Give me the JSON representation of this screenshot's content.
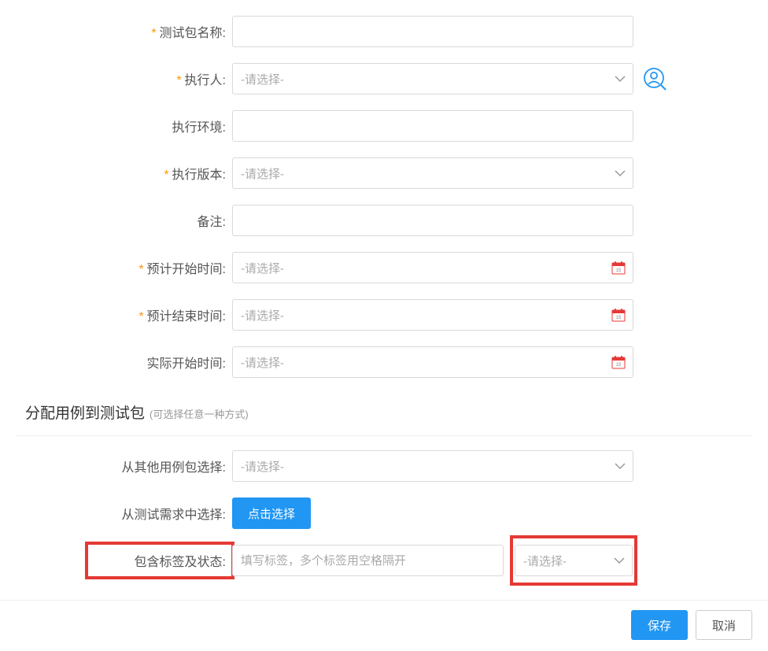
{
  "fields": {
    "package_name": {
      "label": "测试包名称:",
      "required": true,
      "value": ""
    },
    "executor": {
      "label": "执行人:",
      "required": true,
      "placeholder": "-请选择-"
    },
    "env": {
      "label": "执行环境:",
      "required": false,
      "value": ""
    },
    "version": {
      "label": "执行版本:",
      "required": true,
      "placeholder": "-请选择-"
    },
    "remark": {
      "label": "备注:",
      "required": false,
      "value": ""
    },
    "plan_start": {
      "label": "预计开始时间:",
      "required": true,
      "placeholder": "-请选择-"
    },
    "plan_end": {
      "label": "预计结束时间:",
      "required": true,
      "placeholder": "-请选择-"
    },
    "actual_start": {
      "label": "实际开始时间:",
      "required": false,
      "placeholder": "-请选择-"
    }
  },
  "section": {
    "title": "分配用例到测试包",
    "hint": "(可选择任意一种方式)"
  },
  "assign": {
    "from_other": {
      "label": "从其他用例包选择:",
      "placeholder": "-请选择-"
    },
    "from_req": {
      "label": "从测试需求中选择:",
      "button": "点击选择"
    },
    "tags": {
      "label": "包含标签及状态:",
      "placeholder": "填写标签，多个标签用空格隔开",
      "status_placeholder": "-请选择-"
    }
  },
  "footer": {
    "save": "保存",
    "cancel": "取消"
  }
}
